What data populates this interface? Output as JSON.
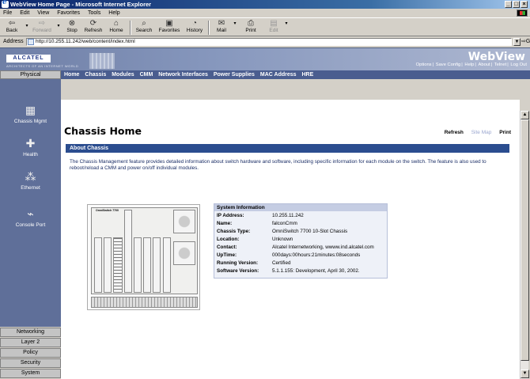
{
  "window": {
    "title": "WebView Home Page - Microsoft Internet Explorer",
    "min": "_",
    "max": "□",
    "close": "×"
  },
  "menu": [
    "File",
    "Edit",
    "View",
    "Favorites",
    "Tools",
    "Help"
  ],
  "toolbar": {
    "back": "Back",
    "forward": "Forward",
    "stop": "Stop",
    "refresh": "Refresh",
    "home": "Home",
    "search": "Search",
    "favorites": "Favorites",
    "history": "History",
    "mail": "Mail",
    "print": "Print",
    "edit": "Edit"
  },
  "address": {
    "label": "Address",
    "url": "http://10.255.11.242/web/content/index.html",
    "go": "Go"
  },
  "banner": {
    "logo": "ALCATEL",
    "tagline": "ARCHITECTS OF AN INTERNET WORLD",
    "title": "WebView",
    "links": [
      "Options",
      "Save Config",
      "Help",
      "About",
      "Telnet",
      "Log Out"
    ]
  },
  "left_tab": "Physical",
  "top_nav": [
    "Home",
    "Chassis",
    "Modules",
    "CMM",
    "Network Interfaces",
    "Power Supplies",
    "MAC Address",
    "HRE"
  ],
  "sidebar": {
    "items": [
      {
        "label": "Chassis Mgmt",
        "icon": "chassis-icon"
      },
      {
        "label": "Health",
        "icon": "health-icon"
      },
      {
        "label": "Ethernet",
        "icon": "ethernet-icon"
      },
      {
        "label": "Console Port",
        "icon": "console-port-icon"
      }
    ],
    "tabs": [
      "Networking",
      "Layer 2",
      "Policy",
      "Security",
      "System"
    ]
  },
  "page": {
    "title": "Chassis Home",
    "links": {
      "refresh": "Refresh",
      "sitemap": "Site Map",
      "print": "Print"
    },
    "section": "About Chassis",
    "description": "The Chassis Management feature provides detailed information about switch hardware and software, including specific information for each module on the switch. The feature is also used to reboot/reload a CMM and power on/off individual modules.",
    "chassis_label": "OmniSwitch 7700"
  },
  "system_info": {
    "header": "System Information",
    "rows": [
      {
        "k": "IP Address:",
        "v": "10.255.11.242"
      },
      {
        "k": "Name:",
        "v": "falconCmm"
      },
      {
        "k": "Chassis Type:",
        "v": "OmniSwitch 7700 10-Slot Chassis"
      },
      {
        "k": "Location:",
        "v": "Unknown"
      },
      {
        "k": "Contact:",
        "v": "Alcatel Internetworking, wwww.ind.alcatel.com"
      },
      {
        "k": "UpTime:",
        "v": "000days:00hours:21minutes:08seconds"
      },
      {
        "k": "Running Version:",
        "v": "Certified"
      },
      {
        "k": "Software Version:",
        "v": "5.1.1.155: Development, April 30, 2002."
      }
    ]
  }
}
